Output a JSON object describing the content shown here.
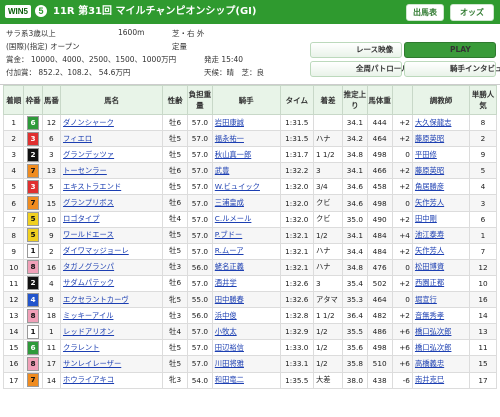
{
  "header": {
    "logo_text": "WIN5",
    "race_no_badge": "5",
    "race_title": "11R 第31回 マイルチャンピオンシップ(GI)",
    "print_btn": "出馬表",
    "odds_btn": "オッズ"
  },
  "info": {
    "line1_left": "サラ系3歳以上",
    "line1_mid": "1600m",
    "line1_right": "芝・右 外",
    "line2_left": "(国際)(指定) オープン",
    "line2_right": "定量",
    "line3_left": "賞金： 10000、4000、2500、1500、1000万円",
    "line3_right": "発走 15:40",
    "line4_left": "付加賞： 852.2、108.2、 54.6万円",
    "line4_right": "天候：晴　芝：良",
    "btn_video": "レース映像",
    "btn_play": "PLAY",
    "btn_patrol": "全周パトロール",
    "btn_interview": "騎手インタビュー"
  },
  "table_headers": [
    "着順",
    "枠番",
    "馬番",
    "馬名",
    "性齢",
    "負担重量",
    "騎手",
    "タイム",
    "着差",
    "推定上り",
    "馬体重",
    "",
    "調教師",
    "単勝人気"
  ],
  "rows": [
    {
      "rank": "1",
      "waku": "6",
      "num": "12",
      "name": "ダノンシャーク",
      "sex": "牡6",
      "weight": "57.0",
      "jockey": "岩田康誠",
      "time": "1:31.5",
      "margin": "",
      "last": "34.1",
      "body": "444",
      "diff": "+2",
      "trainer": "大久保龍志",
      "pop": "8"
    },
    {
      "rank": "2",
      "waku": "3",
      "num": "6",
      "name": "フィエロ",
      "sex": "牡5",
      "weight": "57.0",
      "jockey": "福永祐一",
      "time": "1:31.5",
      "margin": "ハナ",
      "last": "34.2",
      "body": "464",
      "diff": "+2",
      "trainer": "藤原英昭",
      "pop": "2"
    },
    {
      "rank": "3",
      "waku": "2",
      "num": "3",
      "name": "グランデッツァ",
      "sex": "牡5",
      "weight": "57.0",
      "jockey": "秋山真一郎",
      "time": "1:31.7",
      "margin": "1 1/2",
      "last": "34.8",
      "body": "498",
      "diff": "0",
      "trainer": "平田修",
      "pop": "9"
    },
    {
      "rank": "4",
      "waku": "7",
      "num": "13",
      "name": "トーセンラー",
      "sex": "牡6",
      "weight": "57.0",
      "jockey": "武豊",
      "time": "1:32.2",
      "margin": "3",
      "last": "34.1",
      "body": "466",
      "diff": "+2",
      "trainer": "藤原英昭",
      "pop": "5"
    },
    {
      "rank": "5",
      "waku": "3",
      "num": "5",
      "name": "エキストラエンド",
      "sex": "牡5",
      "weight": "57.0",
      "jockey": "W.ビュイック",
      "time": "1:32.0",
      "margin": "3/4",
      "last": "34.6",
      "body": "458",
      "diff": "+2",
      "trainer": "角居勝彦",
      "pop": "4"
    },
    {
      "rank": "6",
      "waku": "7",
      "num": "15",
      "name": "グランプリボス",
      "sex": "牡6",
      "weight": "57.0",
      "jockey": "三浦皇成",
      "time": "1:32.0",
      "margin": "クビ",
      "last": "34.6",
      "body": "498",
      "diff": "0",
      "trainer": "矢作芳人",
      "pop": "3"
    },
    {
      "rank": "7",
      "waku": "5",
      "num": "10",
      "name": "ロゴタイプ",
      "sex": "牡4",
      "weight": "57.0",
      "jockey": "C.ルメール",
      "time": "1:32.0",
      "margin": "クビ",
      "last": "35.0",
      "body": "490",
      "diff": "+2",
      "trainer": "田中剛",
      "pop": "6"
    },
    {
      "rank": "8",
      "waku": "5",
      "num": "9",
      "name": "ワールドエース",
      "sex": "牡5",
      "weight": "57.0",
      "jockey": "P.ブドー",
      "time": "1:32.1",
      "margin": "1/2",
      "last": "34.1",
      "body": "484",
      "diff": "+4",
      "trainer": "池江泰寿",
      "pop": "1"
    },
    {
      "rank": "9",
      "waku": "1",
      "num": "2",
      "name": "ダイワマッジョーレ",
      "sex": "牡5",
      "weight": "57.0",
      "jockey": "R.ムーア",
      "time": "1:32.1",
      "margin": "ハナ",
      "last": "34.4",
      "body": "484",
      "diff": "+2",
      "trainer": "矢作芳人",
      "pop": "7"
    },
    {
      "rank": "10",
      "waku": "8",
      "num": "16",
      "name": "タガノグランパ",
      "sex": "牡3",
      "weight": "56.0",
      "jockey": "蛯名正義",
      "time": "1:32.1",
      "margin": "ハナ",
      "last": "34.8",
      "body": "476",
      "diff": "0",
      "trainer": "松田博資",
      "pop": "12"
    },
    {
      "rank": "11",
      "waku": "2",
      "num": "4",
      "name": "サダムパテック",
      "sex": "牡6",
      "weight": "57.0",
      "jockey": "酒井学",
      "time": "1:32.6",
      "margin": "3",
      "last": "35.4",
      "body": "502",
      "diff": "+2",
      "trainer": "西園正都",
      "pop": "10"
    },
    {
      "rank": "12",
      "waku": "4",
      "num": "8",
      "name": "エクセラントカーヴ",
      "sex": "牝5",
      "weight": "55.0",
      "jockey": "田中勝春",
      "time": "1:32.6",
      "margin": "アタマ",
      "last": "35.3",
      "body": "464",
      "diff": "0",
      "trainer": "堀宣行",
      "pop": "16"
    },
    {
      "rank": "13",
      "waku": "8",
      "num": "18",
      "name": "ミッキーアイル",
      "sex": "牡3",
      "weight": "56.0",
      "jockey": "浜中俊",
      "time": "1:32.8",
      "margin": "1 1/2",
      "last": "36.4",
      "body": "482",
      "diff": "+2",
      "trainer": "音無秀孝",
      "pop": "14"
    },
    {
      "rank": "14",
      "waku": "1",
      "num": "1",
      "name": "レッドアリオン",
      "sex": "牡4",
      "weight": "57.0",
      "jockey": "小牧太",
      "time": "1:32.9",
      "margin": "1/2",
      "last": "35.5",
      "body": "486",
      "diff": "+6",
      "trainer": "橋口弘次郎",
      "pop": "13"
    },
    {
      "rank": "15",
      "waku": "6",
      "num": "11",
      "name": "クラレント",
      "sex": "牡5",
      "weight": "57.0",
      "jockey": "田辺裕信",
      "time": "1:33.0",
      "margin": "1/2",
      "last": "35.6",
      "body": "498",
      "diff": "+6",
      "trainer": "橋口弘次郎",
      "pop": "11"
    },
    {
      "rank": "16",
      "waku": "8",
      "num": "17",
      "name": "サンレイレーザー",
      "sex": "牡5",
      "weight": "57.0",
      "jockey": "川田将雅",
      "time": "1:33.1",
      "margin": "1/2",
      "last": "35.8",
      "body": "510",
      "diff": "+6",
      "trainer": "高橋義忠",
      "pop": "15"
    },
    {
      "rank": "17",
      "waku": "7",
      "num": "14",
      "name": "ホウライアキコ",
      "sex": "牝3",
      "weight": "54.0",
      "jockey": "和田竜二",
      "time": "1:35.5",
      "margin": "大差",
      "last": "38.0",
      "body": "438",
      "diff": "-6",
      "trainer": "南井克巳",
      "pop": "17"
    }
  ],
  "colors": {
    "w1": "#ffffff",
    "w2": "#111111",
    "w3": "#e03030",
    "w4": "#2255cc",
    "w5": "#f0d020",
    "w6": "#2e9a3a",
    "w7": "#f08c20",
    "w8": "#f0a0b8"
  }
}
